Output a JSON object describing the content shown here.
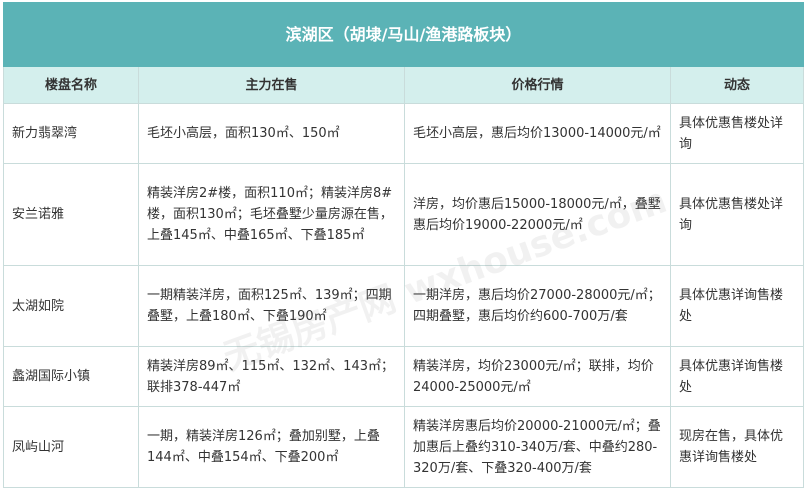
{
  "table": {
    "title": "滨湖区（胡埭/马山/渔港路板块）",
    "headers": [
      "楼盘名称",
      "主力在售",
      "价格行情",
      "动态"
    ],
    "rows": [
      {
        "name": "新力翡翠湾",
        "main_sale": "毛坯小高层，面积130㎡、150㎡",
        "price": "毛坯小高层，惠后均价13000-14000元/㎡",
        "status": "具体优惠售楼处详询"
      },
      {
        "name": "安兰诺雅",
        "main_sale": "精装洋房2#楼，面积110㎡；精装洋房8#楼，面积130㎡；毛坯叠墅少量房源在售，上叠145㎡、中叠165㎡、下叠185㎡",
        "price": "洋房，均价惠后15000-18000元/㎡，叠墅惠后均价19000-22000元/㎡",
        "status": "具体优惠售楼处详询"
      },
      {
        "name": "太湖如院",
        "main_sale": "一期精装洋房，面积125㎡、139㎡；四期叠墅，上叠180㎡、下叠190㎡",
        "price": "一期洋房，惠后均价27000-28000元/㎡；四期叠墅，惠后均价约600-700万/套",
        "status": "具体优惠详询售楼处"
      },
      {
        "name": "蠡湖国际小镇",
        "main_sale": "精装洋房89㎡、115㎡、132㎡、143㎡；联排378-447㎡",
        "price": "精装洋房，均价23000元/㎡；联排，均价24000-25000元/㎡",
        "status": "具体优惠详询售楼处"
      },
      {
        "name": "凤屿山河",
        "main_sale": "一期，精装洋房126㎡；叠加别墅，上叠144㎡、中叠154㎡、下叠200㎡",
        "price": "精装洋房惠后均价20000-21000元/㎡；叠加惠后上叠约310-340万/套、中叠约280-320万/套、下叠320-400万/套",
        "status": "现房在售，具体优惠详询售楼处"
      }
    ]
  },
  "watermark": "无锡房产网 wxhouse.com"
}
